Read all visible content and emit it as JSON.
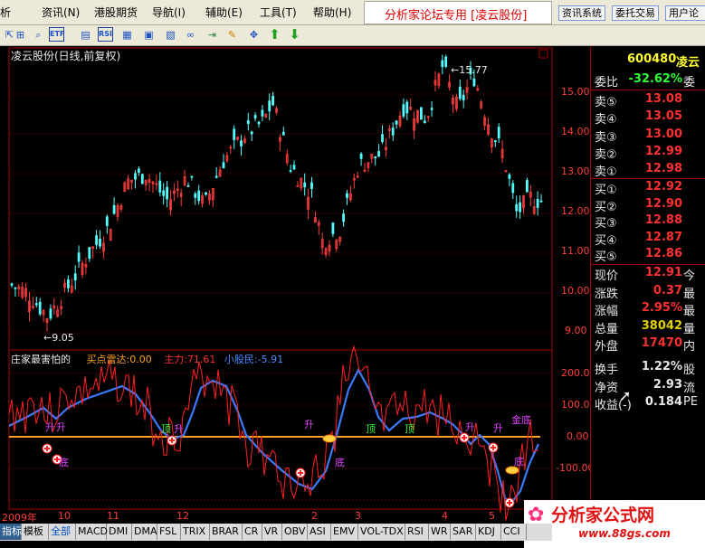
{
  "menubar": {
    "items": [
      "析",
      "资讯(N)",
      "港股期货",
      "导航(I)",
      "辅助(E)",
      "工具(T)",
      "帮助(H)"
    ],
    "brand": "分析家论坛专用 [凌云股份]",
    "buttons": [
      "资讯系统",
      "委托交易",
      "用户论"
    ]
  },
  "toolbar": {
    "icons": [
      "cursor-icon",
      "zoom-icon",
      "search-icon",
      "etf-icon",
      "chart-icon",
      "rsi-icon",
      "table-icon",
      "window-icon",
      "link-icon",
      "export-icon",
      "pen-icon",
      "move-icon",
      "up-arrow-icon",
      "down-arrow-icon"
    ],
    "labels": {
      "etf": "ETF",
      "rsi": "RSI"
    }
  },
  "kline": {
    "title": "凌云股份(日线,前复权)",
    "price_ticks": [
      "15.00",
      "14.00",
      "13.00",
      "12.00",
      "11.00",
      "10.00",
      "9.00"
    ],
    "high_label": "15.77",
    "low_label": "9.05"
  },
  "indicator": {
    "name": "庄家最害怕的",
    "buy_radar": "买点雷达:0.00",
    "main_force": "主力:71.61",
    "retail": "小股民:-5.91",
    "ticks": [
      "200.00",
      "100.00",
      "0.00",
      "-100.00",
      "-200.00"
    ],
    "signals": {
      "up": "升",
      "top": "顶",
      "bottom": "底",
      "golden": "金底"
    }
  },
  "time_axis": [
    "2009年",
    "10",
    "11",
    "12",
    "2",
    "3",
    "4",
    "5"
  ],
  "quote": {
    "code": "600480",
    "name": "凌云",
    "weibi": {
      "label": "委比",
      "value": "-32.62%",
      "extra": "委"
    },
    "sells": [
      {
        "label": "卖⑤",
        "price": "13.08"
      },
      {
        "label": "卖④",
        "price": "13.05"
      },
      {
        "label": "卖③",
        "price": "13.00"
      },
      {
        "label": "卖②",
        "price": "12.99"
      },
      {
        "label": "卖①",
        "price": "12.98"
      }
    ],
    "buys": [
      {
        "label": "买①",
        "price": "12.92"
      },
      {
        "label": "买②",
        "price": "12.90"
      },
      {
        "label": "买③",
        "price": "12.88"
      },
      {
        "label": "买④",
        "price": "12.87"
      },
      {
        "label": "买⑤",
        "price": "12.86"
      }
    ],
    "stats": [
      {
        "label": "现价",
        "value": "12.91",
        "extra": "今",
        "color": "#ff3030"
      },
      {
        "label": "涨跌",
        "value": "0.37",
        "extra": "最",
        "color": "#ff3030"
      },
      {
        "label": "涨幅",
        "value": "2.95%",
        "extra": "最",
        "color": "#ff3030"
      },
      {
        "label": "总量",
        "value": "38042",
        "extra": "量",
        "color": "#e0d000"
      },
      {
        "label": "外盘",
        "value": "17470",
        "extra": "内",
        "color": "#ff3030"
      },
      {
        "label": "换手",
        "value": "1.22%",
        "extra": "股",
        "color": "#e8e8e8"
      },
      {
        "label": "净资",
        "value": "2.93",
        "extra": "流",
        "color": "#e8e8e8"
      },
      {
        "label": "收益(-)",
        "value": "0.184",
        "extra": "PE",
        "color": "#e8e8e8"
      }
    ]
  },
  "tabs": [
    "指标",
    "模板",
    "全部",
    "MACD",
    "DMI",
    "DMA",
    "FSL",
    "TRIX",
    "BRAR",
    "CR",
    "VR",
    "OBV",
    "ASI",
    "EMV",
    "VOL-TDX",
    "RSI",
    "WR",
    "SAR",
    "KDJ",
    "CCI"
  ],
  "watermark": {
    "title": "分析家公式网",
    "url": "www.88gs.com"
  },
  "colors": {
    "up": "#ff3c3c",
    "down": "#54ffff",
    "ma_line": "#ffa020",
    "main_force": "#ff2020",
    "retail": "#3070ff"
  }
}
